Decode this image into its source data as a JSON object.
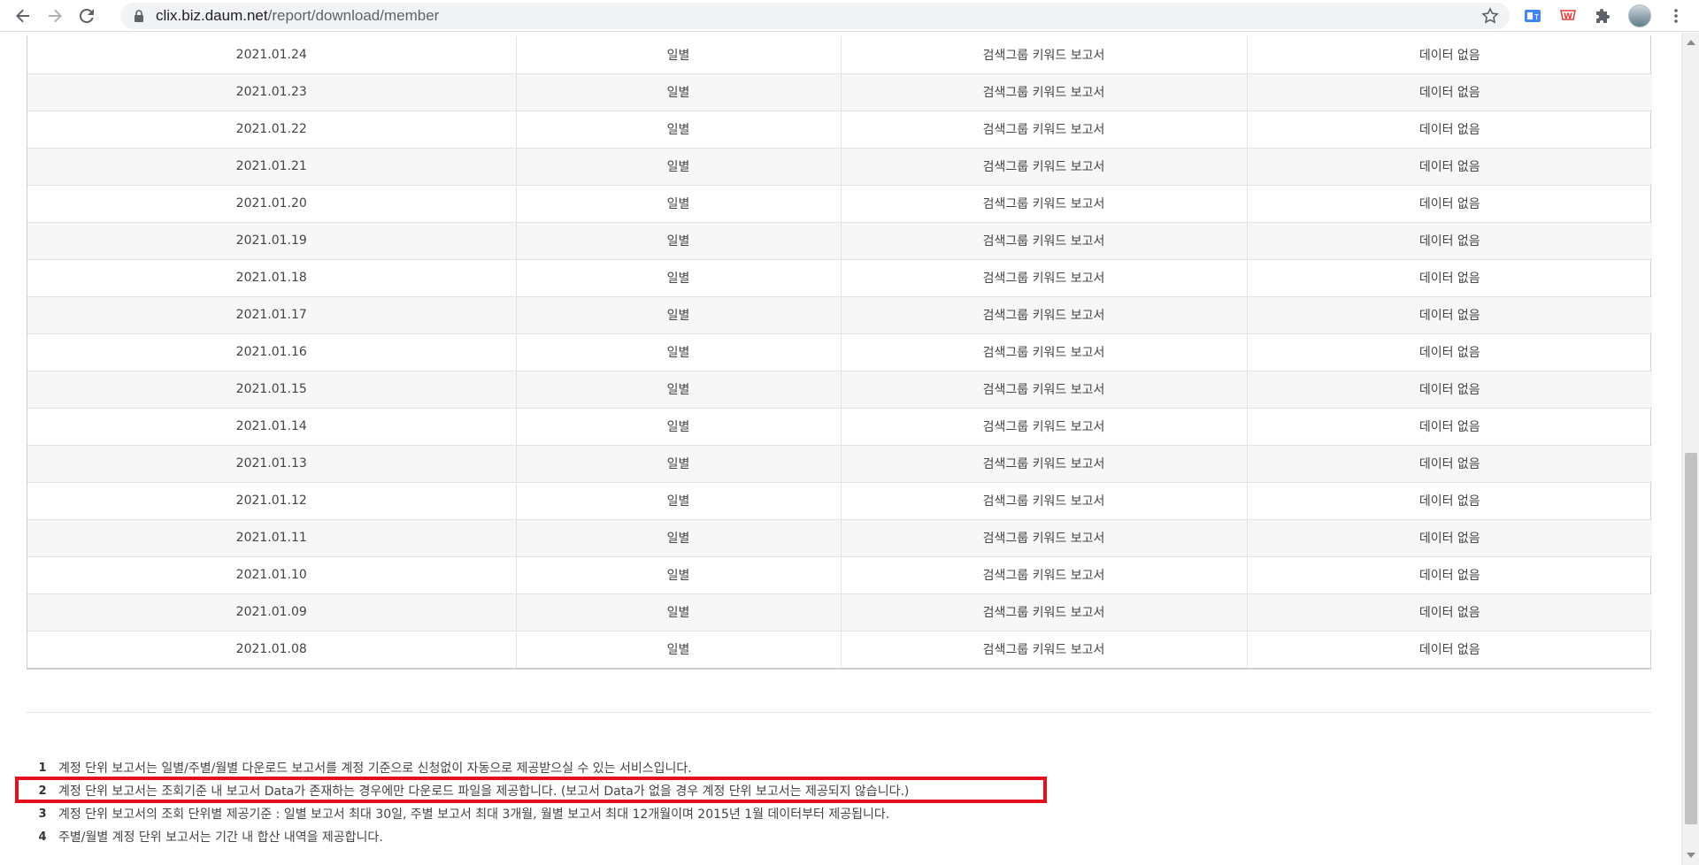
{
  "browser": {
    "url_host": "clix.biz.daum.net",
    "url_path": "/report/download/member"
  },
  "table": {
    "rows": [
      {
        "date": "2021.01.24",
        "period": "일별",
        "report": "검색그룹 키워드 보고서",
        "status": "데이터 없음"
      },
      {
        "date": "2021.01.23",
        "period": "일별",
        "report": "검색그룹 키워드 보고서",
        "status": "데이터 없음"
      },
      {
        "date": "2021.01.22",
        "period": "일별",
        "report": "검색그룹 키워드 보고서",
        "status": "데이터 없음"
      },
      {
        "date": "2021.01.21",
        "period": "일별",
        "report": "검색그룹 키워드 보고서",
        "status": "데이터 없음"
      },
      {
        "date": "2021.01.20",
        "period": "일별",
        "report": "검색그룹 키워드 보고서",
        "status": "데이터 없음"
      },
      {
        "date": "2021.01.19",
        "period": "일별",
        "report": "검색그룹 키워드 보고서",
        "status": "데이터 없음"
      },
      {
        "date": "2021.01.18",
        "period": "일별",
        "report": "검색그룹 키워드 보고서",
        "status": "데이터 없음"
      },
      {
        "date": "2021.01.17",
        "period": "일별",
        "report": "검색그룹 키워드 보고서",
        "status": "데이터 없음"
      },
      {
        "date": "2021.01.16",
        "period": "일별",
        "report": "검색그룹 키워드 보고서",
        "status": "데이터 없음"
      },
      {
        "date": "2021.01.15",
        "period": "일별",
        "report": "검색그룹 키워드 보고서",
        "status": "데이터 없음"
      },
      {
        "date": "2021.01.14",
        "period": "일별",
        "report": "검색그룹 키워드 보고서",
        "status": "데이터 없음"
      },
      {
        "date": "2021.01.13",
        "period": "일별",
        "report": "검색그룹 키워드 보고서",
        "status": "데이터 없음"
      },
      {
        "date": "2021.01.12",
        "period": "일별",
        "report": "검색그룹 키워드 보고서",
        "status": "데이터 없음"
      },
      {
        "date": "2021.01.11",
        "period": "일별",
        "report": "검색그룹 키워드 보고서",
        "status": "데이터 없음"
      },
      {
        "date": "2021.01.10",
        "period": "일별",
        "report": "검색그룹 키워드 보고서",
        "status": "데이터 없음"
      },
      {
        "date": "2021.01.09",
        "period": "일별",
        "report": "검색그룹 키워드 보고서",
        "status": "데이터 없음"
      },
      {
        "date": "2021.01.08",
        "period": "일별",
        "report": "검색그룹 키워드 보고서",
        "status": "데이터 없음"
      }
    ]
  },
  "notes": [
    {
      "num": "1",
      "text": "계정 단위 보고서는 일별/주별/월별 다운로드 보고서를 계정 기준으로 신청없이 자동으로 제공받으실 수 있는 서비스입니다."
    },
    {
      "num": "2",
      "text": "계정 단위 보고서는 조회기준 내 보고서 Data가 존재하는 경우에만 다운로드 파일을 제공합니다. (보고서 Data가 없을 경우 계정 단위 보고서는 제공되지 않습니다.)"
    },
    {
      "num": "3",
      "text": "계정 단위 보고서의 조회 단위별 제공기준 : 일별 보고서 최대 30일, 주별 보고서 최대 3개월, 월별 보고서 최대 12개월이며 2015년 1월 데이터부터 제공됩니다."
    },
    {
      "num": "4",
      "text": "주별/월별 계정 단위 보고서는 기간 내 합산 내역을 제공합니다."
    }
  ],
  "colors": {
    "highlight": "#e3101d"
  },
  "icons": [
    "back-arrow-icon",
    "forward-arrow-icon",
    "reload-icon",
    "lock-icon",
    "star-icon",
    "extension-icons",
    "puzzle-icon",
    "avatar",
    "kebab-menu-icon"
  ]
}
